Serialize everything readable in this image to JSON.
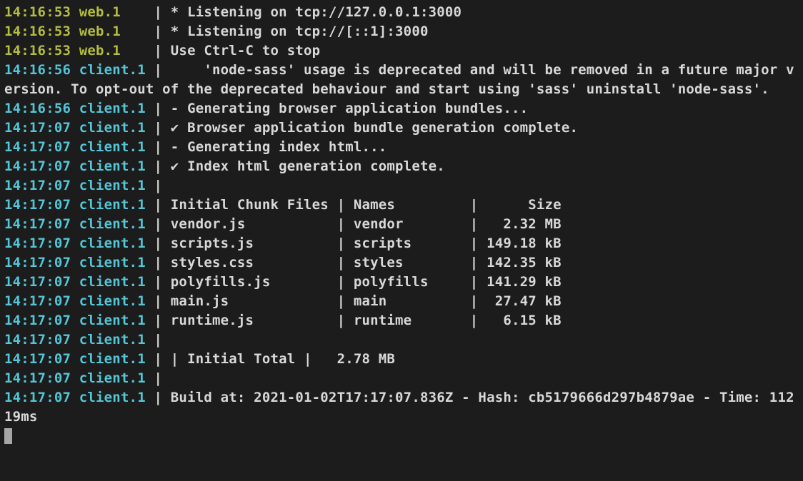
{
  "lines": [
    {
      "ts": "14:16:53",
      "src": "web.1   ",
      "cls": "ts-web",
      "rest": " * Listening on tcp://127.0.0.1:3000"
    },
    {
      "ts": "14:16:53",
      "src": "web.1   ",
      "cls": "ts-web",
      "rest": " * Listening on tcp://[::1]:3000"
    },
    {
      "ts": "14:16:53",
      "src": "web.1   ",
      "cls": "ts-web",
      "rest": " Use Ctrl-C to stop"
    },
    {
      "ts": "14:16:56",
      "src": "client.1",
      "cls": "ts-client",
      "rest": "     'node-sass' usage is deprecated and will be removed in a future major version. To opt-out of the deprecated behaviour and start using 'sass' uninstall 'node-sass'."
    },
    {
      "ts": "14:16:56",
      "src": "client.1",
      "cls": "ts-client",
      "rest": " - Generating browser application bundles..."
    },
    {
      "ts": "14:17:07",
      "src": "client.1",
      "cls": "ts-client",
      "rest": " ✔ Browser application bundle generation complete."
    },
    {
      "ts": "14:17:07",
      "src": "client.1",
      "cls": "ts-client",
      "rest": " - Generating index html..."
    },
    {
      "ts": "14:17:07",
      "src": "client.1",
      "cls": "ts-client",
      "rest": " ✔ Index html generation complete."
    },
    {
      "ts": "14:17:07",
      "src": "client.1",
      "cls": "ts-client",
      "rest": ""
    },
    {
      "ts": "14:17:07",
      "src": "client.1",
      "cls": "ts-client",
      "rest": " Initial Chunk Files | Names         |      Size"
    },
    {
      "ts": "14:17:07",
      "src": "client.1",
      "cls": "ts-client",
      "rest": " vendor.js           | vendor        |   2.32 MB"
    },
    {
      "ts": "14:17:07",
      "src": "client.1",
      "cls": "ts-client",
      "rest": " scripts.js          | scripts       | 149.18 kB"
    },
    {
      "ts": "14:17:07",
      "src": "client.1",
      "cls": "ts-client",
      "rest": " styles.css          | styles        | 142.35 kB"
    },
    {
      "ts": "14:17:07",
      "src": "client.1",
      "cls": "ts-client",
      "rest": " polyfills.js        | polyfills     | 141.29 kB"
    },
    {
      "ts": "14:17:07",
      "src": "client.1",
      "cls": "ts-client",
      "rest": " main.js             | main          |  27.47 kB"
    },
    {
      "ts": "14:17:07",
      "src": "client.1",
      "cls": "ts-client",
      "rest": " runtime.js          | runtime       |   6.15 kB"
    },
    {
      "ts": "14:17:07",
      "src": "client.1",
      "cls": "ts-client",
      "rest": ""
    },
    {
      "ts": "14:17:07",
      "src": "client.1",
      "cls": "ts-client",
      "rest": " | Initial Total |   2.78 MB"
    },
    {
      "ts": "14:17:07",
      "src": "client.1",
      "cls": "ts-client",
      "rest": ""
    },
    {
      "ts": "14:17:07",
      "src": "client.1",
      "cls": "ts-client",
      "rest": " Build at: 2021-01-02T17:17:07.836Z - Hash: cb5179666d297b4879ae - Time: 11219ms"
    }
  ]
}
